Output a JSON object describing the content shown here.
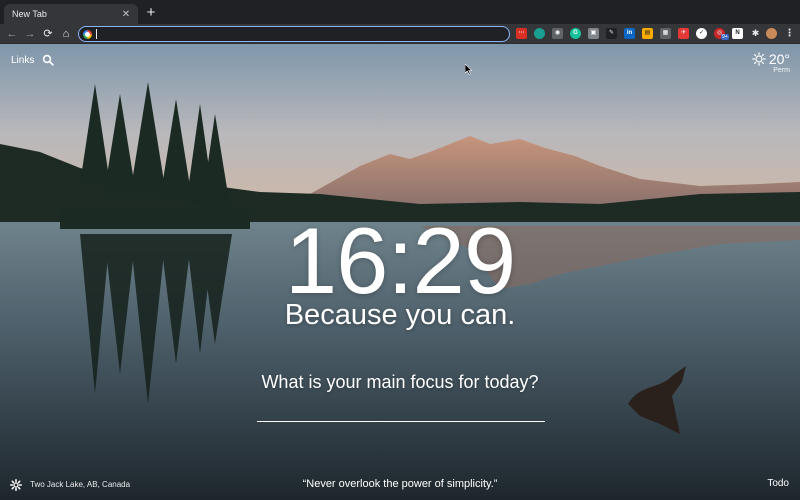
{
  "tabs": [
    {
      "title": "New Tab"
    }
  ],
  "toolbar": {
    "omnibox_value": "",
    "extension_badge": "9+"
  },
  "extensions": [
    {
      "icon": "dots-icon",
      "color": "#d93025"
    },
    {
      "icon": "circle-teal-icon",
      "color": "#1a9e8f"
    },
    {
      "icon": "camera-icon",
      "color": "#5f6368"
    },
    {
      "icon": "grammarly-icon",
      "color": "#15c39a"
    },
    {
      "icon": "briefcase-icon",
      "color": "#80868b"
    },
    {
      "icon": "pen-icon",
      "color": "#202124"
    },
    {
      "icon": "linkedin-icon",
      "color": "#0a66c2"
    },
    {
      "icon": "note-icon",
      "color": "#f9ab00"
    },
    {
      "icon": "grid-icon",
      "color": "#5f6368"
    },
    {
      "icon": "pin-icon",
      "color": "#e53935"
    },
    {
      "icon": "shield-check-icon",
      "color": "#ffffff"
    },
    {
      "icon": "red-rings-icon",
      "color": "#c62828"
    },
    {
      "icon": "notion-icon",
      "color": "#ffffff"
    },
    {
      "icon": "puzzle-icon",
      "color": "#e8eaed"
    }
  ],
  "page": {
    "links_label": "Links",
    "weather": {
      "temp": "20°",
      "city": "Perm"
    },
    "clock": "16:29",
    "greeting": "Because you can.",
    "focus_question": "What is your main focus for today?",
    "focus_value": "",
    "location": "Two Jack Lake, AB, Canada",
    "quote": "“Never overlook the power of simplicity.”",
    "todo_label": "Todo"
  },
  "colors": {
    "tab_bg": "#35363a",
    "chrome_bg": "#202124",
    "omnibox_focus": "#8ab4f8"
  }
}
